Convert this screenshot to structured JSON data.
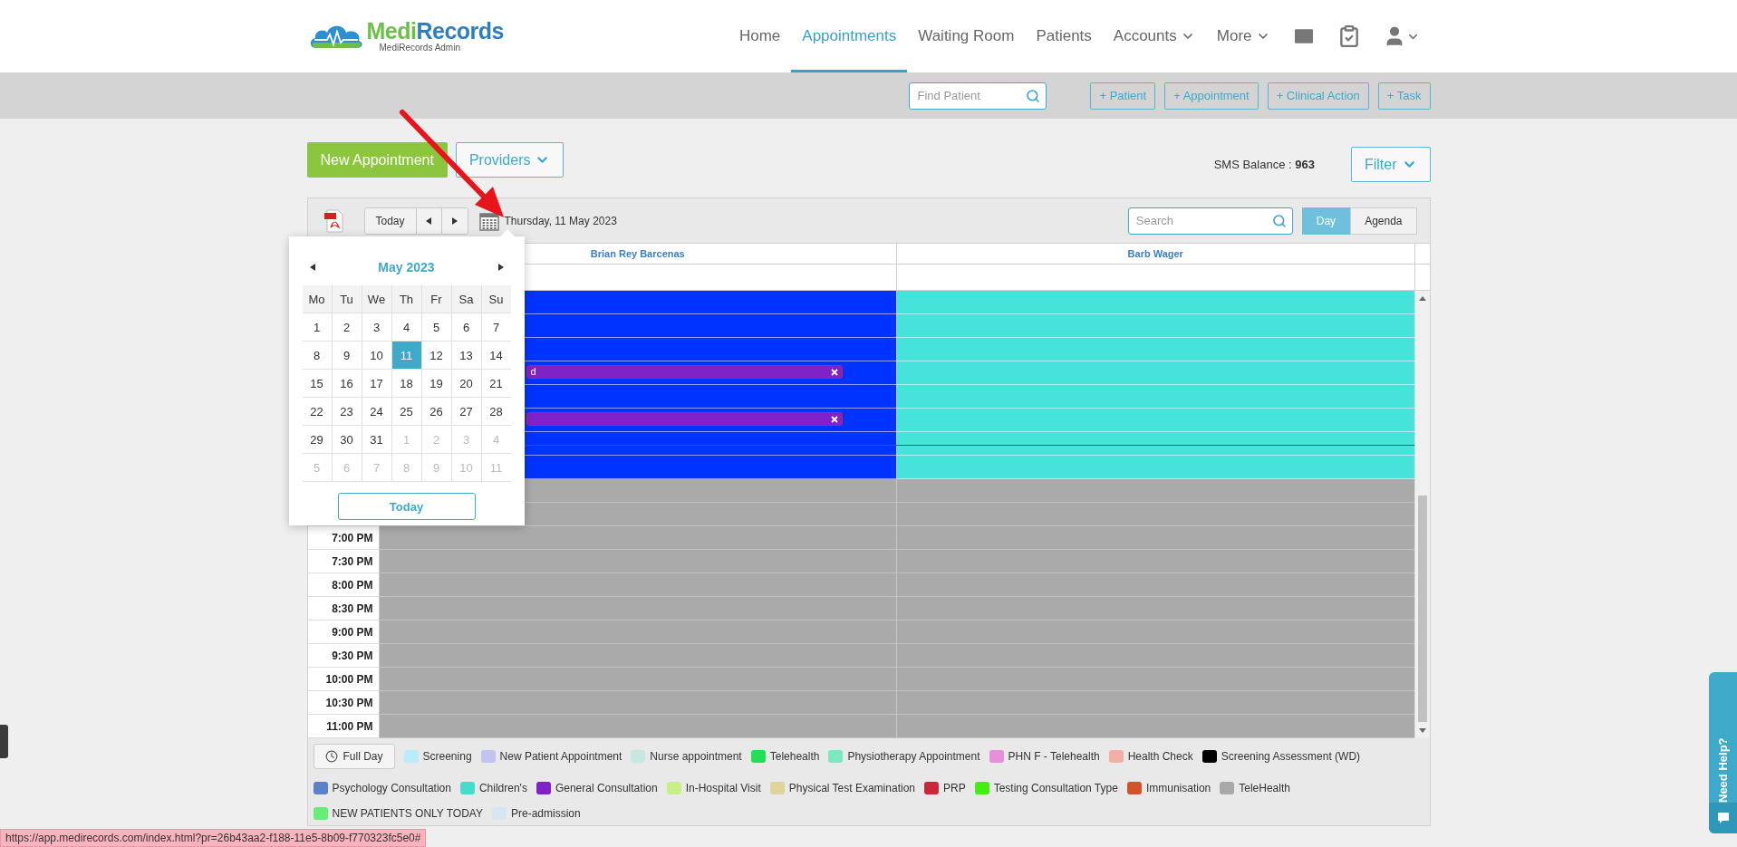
{
  "header": {
    "logo": {
      "name_first": "Medi",
      "name_second": "Records",
      "subtitle": "MediRecords Admin"
    },
    "nav": [
      {
        "label": "Home",
        "selected": false,
        "dropdown": false
      },
      {
        "label": "Appointments",
        "selected": true,
        "dropdown": false
      },
      {
        "label": "Waiting Room",
        "selected": false,
        "dropdown": false
      },
      {
        "label": "Patients",
        "selected": false,
        "dropdown": false
      },
      {
        "label": "Accounts",
        "selected": false,
        "dropdown": true
      },
      {
        "label": "More",
        "selected": false,
        "dropdown": true
      }
    ]
  },
  "quick_bar": {
    "search": {
      "placeholder": "Find Patient"
    },
    "buttons": [
      "+ Patient",
      "+ Appointment",
      "+ Clinical Action",
      "+ Task"
    ]
  },
  "actions": {
    "new_appointment": "New Appointment",
    "providers": "Providers",
    "sms_balance": "SMS Balance : **963**",
    "filter": "Filter"
  },
  "calendar_toolbar": {
    "today": "Today",
    "date": "Thursday, 11 May 2023",
    "search": {
      "placeholder": "Search"
    },
    "views": [
      {
        "label": "Day",
        "selected": true
      },
      {
        "label": "Agenda",
        "selected": false
      }
    ]
  },
  "providers": [
    {
      "name": "Brian Rey Barcenas",
      "color": "#0033ff"
    },
    {
      "name": "Barb Wager",
      "color": "#45e3d9"
    }
  ],
  "rows": [
    {
      "available": true,
      "cells": [
        {
          "booked": false
        },
        {
          "booked": false
        }
      ]
    },
    {
      "available": true,
      "cells": [
        {
          "booked": false
        },
        {
          "booked": false
        }
      ]
    },
    {
      "available": true,
      "cells": [
        {
          "booked": false
        },
        {
          "booked": false
        }
      ]
    },
    {
      "available": true,
      "cells": [
        {
          "booked": true,
          "label": "d"
        },
        {
          "booked": false
        }
      ]
    },
    {
      "available": true,
      "cells": [
        {
          "booked": false
        },
        {
          "booked": false
        }
      ]
    },
    {
      "available": true,
      "cells": [
        {
          "booked": true
        },
        {
          "booked": false
        }
      ]
    },
    {
      "available": true,
      "cells": [
        {
          "booked": false
        },
        {
          "booked": false
        }
      ]
    },
    {
      "available": true,
      "cells": [
        {
          "booked": false
        },
        {
          "booked": false
        }
      ]
    },
    {
      "available": false,
      "cells": [
        {
          "booked": false
        },
        {
          "booked": false
        }
      ]
    },
    {
      "available": false,
      "cells": [
        {
          "booked": false
        },
        {
          "booked": false
        }
      ]
    },
    {
      "time": "7:00 PM",
      "available": false,
      "cells": [
        {
          "booked": false
        },
        {
          "booked": false
        }
      ]
    },
    {
      "time": "7:30 PM",
      "available": false,
      "cells": [
        {
          "booked": false
        },
        {
          "booked": false
        }
      ]
    },
    {
      "time": "8:00 PM",
      "available": false,
      "cells": [
        {
          "booked": false
        },
        {
          "booked": false
        }
      ]
    },
    {
      "time": "8:30 PM",
      "available": false,
      "cells": [
        {
          "booked": false
        },
        {
          "booked": false
        }
      ]
    },
    {
      "time": "9:00 PM",
      "available": false,
      "cells": [
        {
          "booked": false
        },
        {
          "booked": false
        }
      ]
    },
    {
      "time": "9:30 PM",
      "available": false,
      "cells": [
        {
          "booked": false
        },
        {
          "booked": false
        }
      ]
    },
    {
      "time": "10:00 PM",
      "available": false,
      "cells": [
        {
          "booked": false
        },
        {
          "booked": false
        }
      ]
    },
    {
      "time": "10:30 PM",
      "available": false,
      "cells": [
        {
          "booked": false
        },
        {
          "booked": false
        }
      ]
    },
    {
      "time": "11:00 PM",
      "available": false,
      "cells": [
        {
          "booked": false
        },
        {
          "booked": false
        }
      ]
    }
  ],
  "date_picker": {
    "month": "May 2023",
    "weekdays": [
      "Mo",
      "Tu",
      "We",
      "Th",
      "Fr",
      "Sa",
      "Su"
    ],
    "weeks": [
      [
        {
          "day": "1",
          "muted": false,
          "selected": false
        },
        {
          "day": "2",
          "muted": false,
          "selected": false
        },
        {
          "day": "3",
          "muted": false,
          "selected": false
        },
        {
          "day": "4",
          "muted": false,
          "selected": false
        },
        {
          "day": "5",
          "muted": false,
          "selected": false
        },
        {
          "day": "6",
          "muted": false,
          "selected": false
        },
        {
          "day": "7",
          "muted": false,
          "selected": false
        }
      ],
      [
        {
          "day": "8",
          "muted": false,
          "selected": false
        },
        {
          "day": "9",
          "muted": false,
          "selected": false
        },
        {
          "day": "10",
          "muted": false,
          "selected": false
        },
        {
          "day": "11",
          "muted": false,
          "selected": true
        },
        {
          "day": "12",
          "muted": false,
          "selected": false
        },
        {
          "day": "13",
          "muted": false,
          "selected": false
        },
        {
          "day": "14",
          "muted": false,
          "selected": false
        }
      ],
      [
        {
          "day": "15",
          "muted": false,
          "selected": false
        },
        {
          "day": "16",
          "muted": false,
          "selected": false
        },
        {
          "day": "17",
          "muted": false,
          "selected": false
        },
        {
          "day": "18",
          "muted": false,
          "selected": false
        },
        {
          "day": "19",
          "muted": false,
          "selected": false
        },
        {
          "day": "20",
          "muted": false,
          "selected": false
        },
        {
          "day": "21",
          "muted": false,
          "selected": false
        }
      ],
      [
        {
          "day": "22",
          "muted": false,
          "selected": false
        },
        {
          "day": "23",
          "muted": false,
          "selected": false
        },
        {
          "day": "24",
          "muted": false,
          "selected": false
        },
        {
          "day": "25",
          "muted": false,
          "selected": false
        },
        {
          "day": "26",
          "muted": false,
          "selected": false
        },
        {
          "day": "27",
          "muted": false,
          "selected": false
        },
        {
          "day": "28",
          "muted": false,
          "selected": false
        }
      ],
      [
        {
          "day": "29",
          "muted": false,
          "selected": false
        },
        {
          "day": "30",
          "muted": false,
          "selected": false
        },
        {
          "day": "31",
          "muted": false,
          "selected": false
        },
        {
          "day": "1",
          "muted": true,
          "selected": false
        },
        {
          "day": "2",
          "muted": true,
          "selected": false
        },
        {
          "day": "3",
          "muted": true,
          "selected": false
        },
        {
          "day": "4",
          "muted": true,
          "selected": false
        }
      ],
      [
        {
          "day": "5",
          "muted": true,
          "selected": false
        },
        {
          "day": "6",
          "muted": true,
          "selected": false
        },
        {
          "day": "7",
          "muted": true,
          "selected": false
        },
        {
          "day": "8",
          "muted": true,
          "selected": false
        },
        {
          "day": "9",
          "muted": true,
          "selected": false
        },
        {
          "day": "10",
          "muted": true,
          "selected": false
        },
        {
          "day": "11",
          "muted": true,
          "selected": false
        }
      ]
    ],
    "today_button": "Today"
  },
  "legend": {
    "full_day": "Full Day",
    "items": [
      {
        "label": "Screening",
        "color": "#b9ecf8"
      },
      {
        "label": "New Patient Appointment",
        "color": "#c2c3f0"
      },
      {
        "label": "Nurse appointment",
        "color": "#c8e6e2"
      },
      {
        "label": "Telehealth",
        "color": "#22e055"
      },
      {
        "label": "Physiotherapy Appointment",
        "color": "#7de8c0"
      },
      {
        "label": "PHN F - Telehealth",
        "color": "#e590d8"
      },
      {
        "label": "Health Check",
        "color": "#f0b0a8"
      },
      {
        "label": "Screening Assessment (WD)",
        "color": "#000000"
      },
      {
        "label": "Psychology Consultation",
        "color": "#5b82c8"
      },
      {
        "label": "Children's",
        "color": "#45dccc"
      },
      {
        "label": "General Consultation",
        "color": "#7f22cc"
      },
      {
        "label": "In-Hospital Visit",
        "color": "#c8ee88"
      },
      {
        "label": "Physical Test Examination",
        "color": "#e0d49a"
      },
      {
        "label": "PRP",
        "color": "#c8283a"
      },
      {
        "label": "Testing Consultation Type",
        "color": "#44ee11"
      },
      {
        "label": "Immunisation",
        "color": "#d05428"
      },
      {
        "label": "TeleHealth",
        "color": "#a8a8a8"
      },
      {
        "label": "NEW PATIENTS ONLY TODAY",
        "color": "#66ee77"
      },
      {
        "label": "Pre-admission",
        "color": "#d6e6f4"
      }
    ]
  },
  "status_url": "https://app.medirecords.com/index.html?pr=26b43aa2-f188-11e5-8b09-f770323fc5e0#",
  "help_tab": "Need Help?"
}
